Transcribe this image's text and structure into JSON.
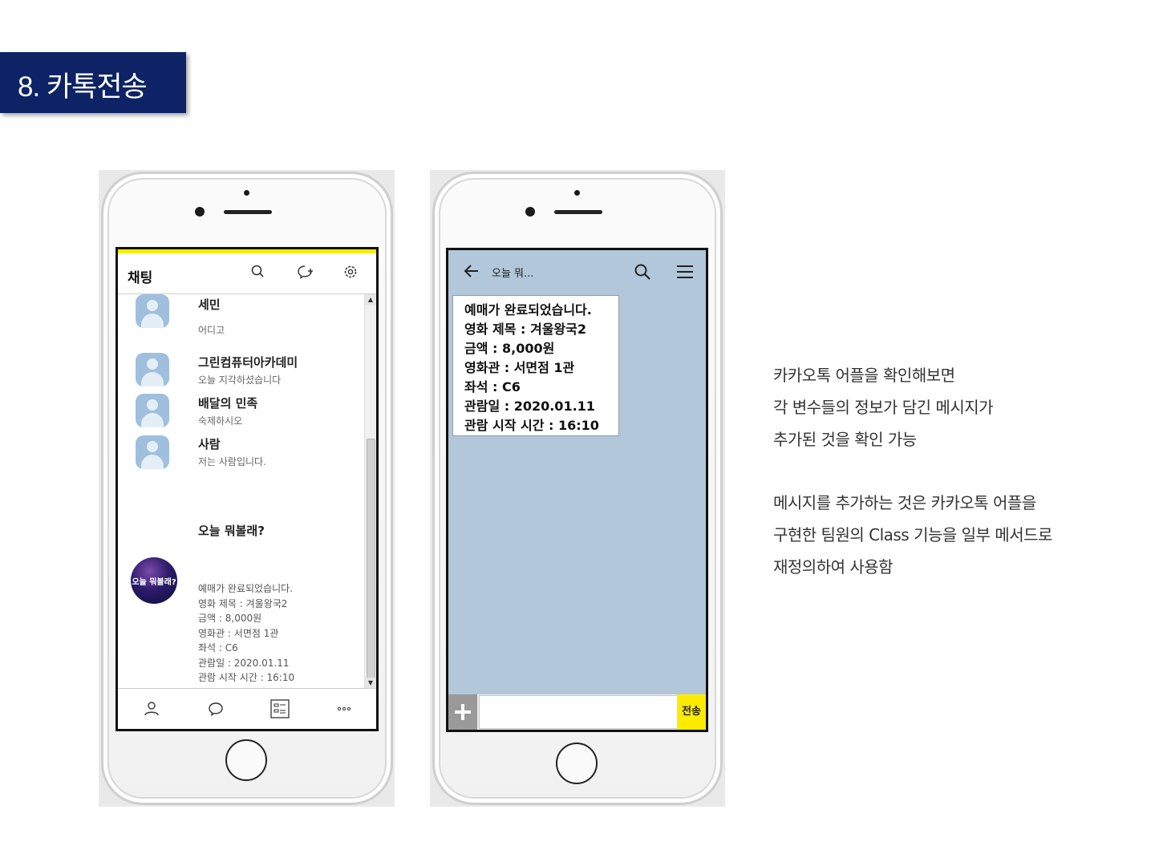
{
  "slide": {
    "title": "8. 카톡전송"
  },
  "chat_list": {
    "header_title": "채팅",
    "items": [
      {
        "name": "세민",
        "preview": "어디고"
      },
      {
        "name": "그린컴퓨터아카데미",
        "preview": "오늘 지각하셨습니다"
      },
      {
        "name": "배달의 민족",
        "preview": "숙제하시오"
      },
      {
        "name": "사람",
        "preview": "저는 사람입니다."
      }
    ],
    "open_chat": {
      "name": "오늘 뭐볼래?",
      "avatar_text": "오늘 뭐볼래?",
      "lines": [
        "예매가 완료되었습니다.",
        "영화 제목 : 겨울왕국2",
        "금액 : 8,000원",
        "영화관 : 서면점 1관",
        "좌석 : C6",
        "관람일 : 2020.01.11",
        "관람 시작 시간 : 16:10"
      ]
    }
  },
  "chat_room": {
    "room_title": "오늘 뭐...",
    "message_lines": [
      "예매가 완료되었습니다.",
      "영화 제목 : 겨울왕국2",
      "금액 : 8,000원",
      "영화관 : 서면점 1관",
      "좌석 : C6",
      "관람일 : 2020.01.11",
      "관람 시작 시간 : 16:10"
    ],
    "send_label": "전송"
  },
  "description": {
    "paragraph1": [
      "카카오톡 어플을 확인해보면",
      "각 변수들의 정보가 담긴 메시지가",
      "추가된 것을 확인 가능"
    ],
    "paragraph2": [
      "메시지를 추가하는 것은 카카오톡 어플을",
      "구현한 팀원의 Class 기능을 일부 메서드로",
      "재정의하여 사용함"
    ]
  },
  "colors": {
    "title_bg": "#0d2366",
    "kakao_yellow": "#ffeb00",
    "chat_bg": "#b2c7d9"
  }
}
